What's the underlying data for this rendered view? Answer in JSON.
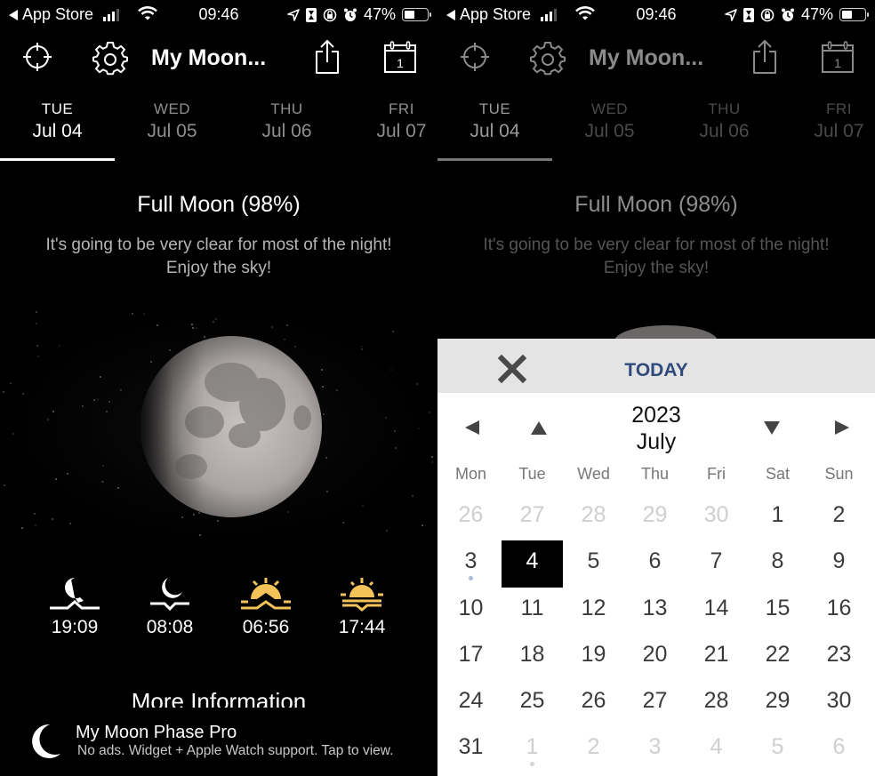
{
  "status_bar": {
    "back_label": "App Store",
    "time": "09:46",
    "battery": "47%",
    "battery_level": 0.47
  },
  "toolbar": {
    "title": "My Moon...",
    "calendar_icon_day": "1",
    "icons": [
      "crosshair-icon",
      "gear-icon",
      "share-icon",
      "calendar-icon"
    ]
  },
  "day_tabs": [
    {
      "dow": "TUE",
      "date": "Jul 04",
      "active": true
    },
    {
      "dow": "WED",
      "date": "Jul 05",
      "active": false
    },
    {
      "dow": "THU",
      "date": "Jul 06",
      "active": false
    },
    {
      "dow": "FRI",
      "date": "Jul 07",
      "active": false
    }
  ],
  "phase": {
    "title": "Full Moon (98%)",
    "description": "It's going to be very clear for most of the night! Enjoy the sky!",
    "illumination": 0.98
  },
  "events": [
    {
      "icon": "moonrise-icon",
      "time": "19:09"
    },
    {
      "icon": "moonset-icon",
      "time": "08:08"
    },
    {
      "icon": "sunrise-icon",
      "time": "06:56"
    },
    {
      "icon": "sunset-icon",
      "time": "17:44"
    }
  ],
  "more_info_label": "More Information",
  "promo": {
    "title": "My Moon Phase Pro",
    "subtitle": "No ads. Widget + Apple Watch support. Tap to view."
  },
  "calendar": {
    "close_icon": "close-icon",
    "today_label": "TODAY",
    "year": "2023",
    "month": "July",
    "weekdays": [
      "Mon",
      "Tue",
      "Wed",
      "Thu",
      "Fri",
      "Sat",
      "Sun"
    ],
    "weeks": [
      [
        {
          "d": "26",
          "other": true
        },
        {
          "d": "27",
          "other": true
        },
        {
          "d": "28",
          "other": true
        },
        {
          "d": "29",
          "other": true
        },
        {
          "d": "30",
          "other": true
        },
        {
          "d": "1"
        },
        {
          "d": "2"
        }
      ],
      [
        {
          "d": "3",
          "dot": true
        },
        {
          "d": "4",
          "selected": true
        },
        {
          "d": "5"
        },
        {
          "d": "6"
        },
        {
          "d": "7"
        },
        {
          "d": "8"
        },
        {
          "d": "9"
        }
      ],
      [
        {
          "d": "10"
        },
        {
          "d": "11"
        },
        {
          "d": "12"
        },
        {
          "d": "13"
        },
        {
          "d": "14"
        },
        {
          "d": "15"
        },
        {
          "d": "16"
        }
      ],
      [
        {
          "d": "17"
        },
        {
          "d": "18"
        },
        {
          "d": "19"
        },
        {
          "d": "20"
        },
        {
          "d": "21"
        },
        {
          "d": "22"
        },
        {
          "d": "23"
        }
      ],
      [
        {
          "d": "24"
        },
        {
          "d": "25"
        },
        {
          "d": "26"
        },
        {
          "d": "27"
        },
        {
          "d": "28"
        },
        {
          "d": "29"
        },
        {
          "d": "30"
        }
      ],
      [
        {
          "d": "31"
        },
        {
          "d": "1",
          "other": true,
          "dot": true
        },
        {
          "d": "2",
          "other": true
        },
        {
          "d": "3",
          "other": true
        },
        {
          "d": "4",
          "other": true
        },
        {
          "d": "5",
          "other": true
        },
        {
          "d": "6",
          "other": true
        }
      ]
    ]
  },
  "colors": {
    "background": "#000000",
    "sun_icon": "#f3c35a",
    "today_link": "#2f4b7c",
    "calendar_header": "#e4e4e4",
    "current_day_dot": "#a9bcd8",
    "next_month_dot": "#d5d5d5"
  }
}
